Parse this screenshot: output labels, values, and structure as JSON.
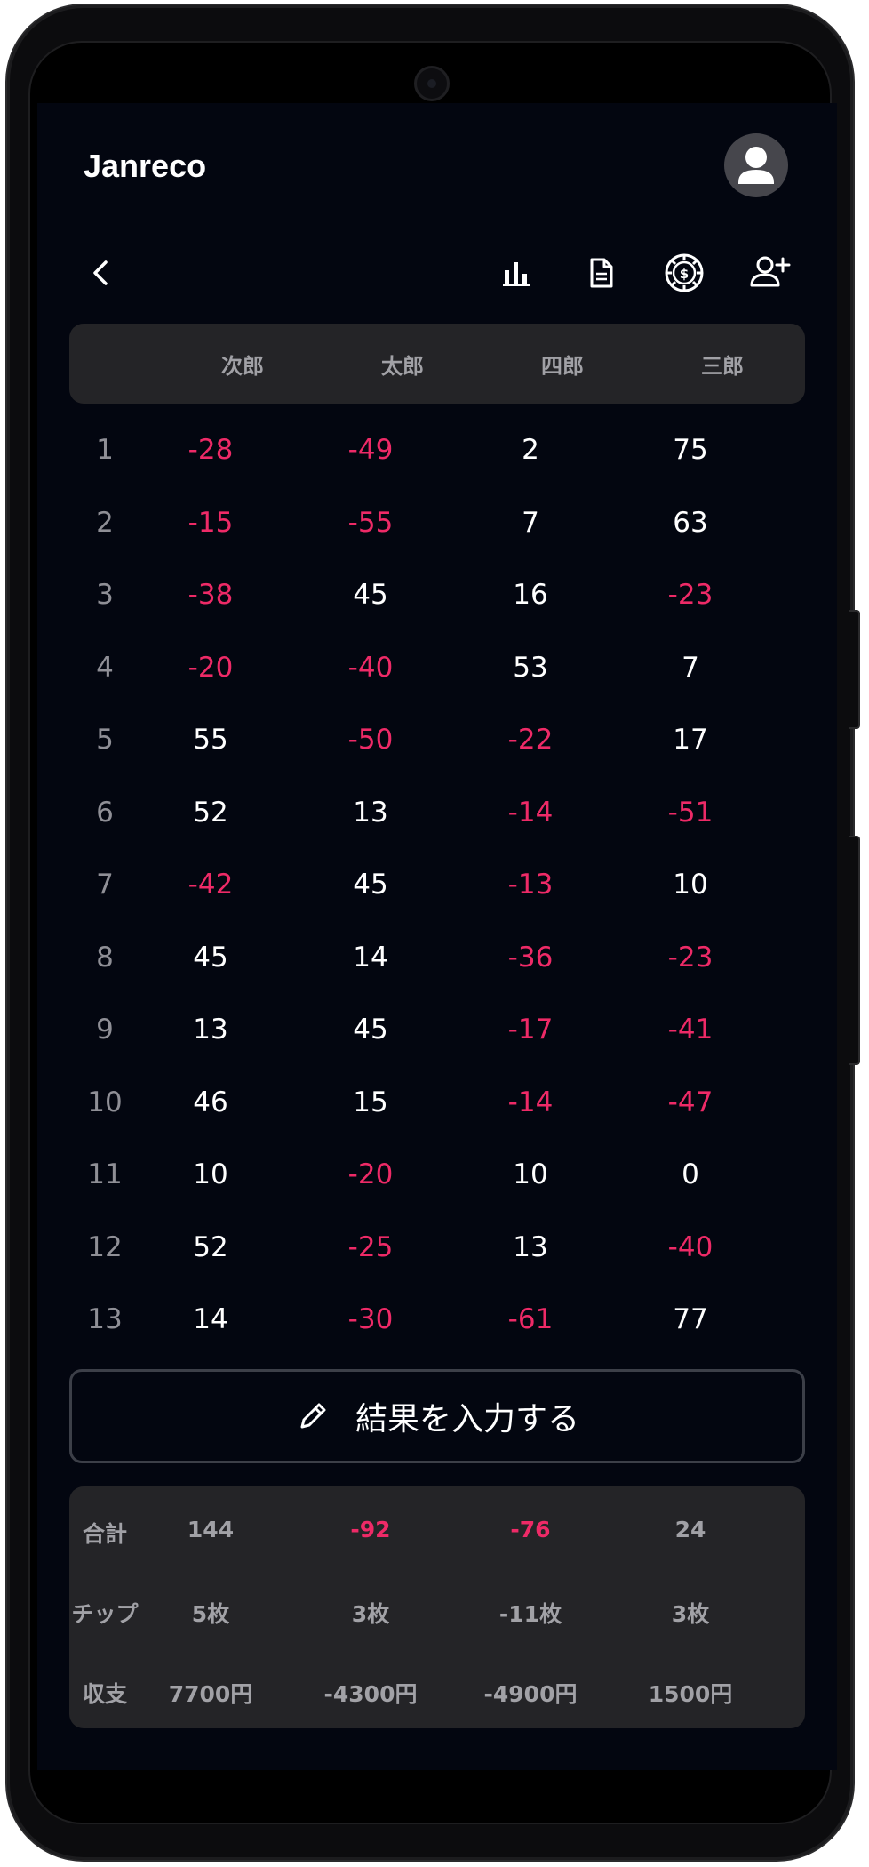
{
  "app": {
    "title": "Janreco"
  },
  "icons": {
    "back": "chevron-left-icon",
    "chart": "bar-chart-icon",
    "document": "document-icon",
    "chip": "chip-coin-icon",
    "add_user": "add-user-icon",
    "avatar": "user-icon",
    "edit": "pencil-icon"
  },
  "colors": {
    "background": "#030610",
    "negative": "#ee2a67",
    "panel": "#242427",
    "muted": "#a1a1a6"
  },
  "table": {
    "players": [
      "次郎",
      "太郎",
      "四郎",
      "三郎"
    ],
    "rows": [
      {
        "no": "1",
        "scores": [
          "-28",
          "-49",
          "2",
          "75"
        ]
      },
      {
        "no": "2",
        "scores": [
          "-15",
          "-55",
          "7",
          "63"
        ]
      },
      {
        "no": "3",
        "scores": [
          "-38",
          "45",
          "16",
          "-23"
        ]
      },
      {
        "no": "4",
        "scores": [
          "-20",
          "-40",
          "53",
          "7"
        ]
      },
      {
        "no": "5",
        "scores": [
          "55",
          "-50",
          "-22",
          "17"
        ]
      },
      {
        "no": "6",
        "scores": [
          "52",
          "13",
          "-14",
          "-51"
        ]
      },
      {
        "no": "7",
        "scores": [
          "-42",
          "45",
          "-13",
          "10"
        ]
      },
      {
        "no": "8",
        "scores": [
          "45",
          "14",
          "-36",
          "-23"
        ]
      },
      {
        "no": "9",
        "scores": [
          "13",
          "45",
          "-17",
          "-41"
        ]
      },
      {
        "no": "10",
        "scores": [
          "46",
          "15",
          "-14",
          "-47"
        ]
      },
      {
        "no": "11",
        "scores": [
          "10",
          "-20",
          "10",
          "0"
        ]
      },
      {
        "no": "12",
        "scores": [
          "52",
          "-25",
          "13",
          "-40"
        ]
      },
      {
        "no": "13",
        "scores": [
          "14",
          "-30",
          "-61",
          "77"
        ]
      }
    ]
  },
  "input_button": {
    "label": "結果を入力する"
  },
  "summary": {
    "rows": [
      {
        "label": "合計",
        "values": [
          "144",
          "-92",
          "-76",
          "24"
        ]
      },
      {
        "label": "チップ",
        "values": [
          "5枚",
          "3枚",
          "-11枚",
          "3枚"
        ]
      },
      {
        "label": "収支",
        "values": [
          "7700円",
          "-4300円",
          "-4900円",
          "1500円"
        ]
      }
    ]
  }
}
